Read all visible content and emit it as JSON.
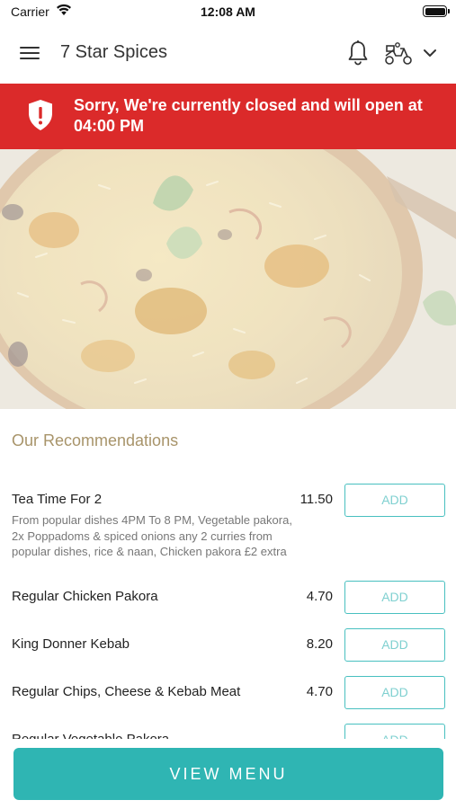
{
  "status_bar": {
    "carrier": "Carrier",
    "time": "12:08 AM",
    "wifi_icon": "wifi-icon",
    "battery_icon": "battery-icon"
  },
  "header": {
    "title": "7 Star Spices",
    "menu_icon": "hamburger-menu-icon",
    "bell_icon": "bell-icon",
    "delivery_icon": "scooter-icon",
    "dropdown_icon": "chevron-down-icon"
  },
  "banner": {
    "text": "Sorry, We're currently closed and will open at 04:00 PM",
    "icon": "shield-alert-icon",
    "background": "#db2a2a"
  },
  "hero": {
    "icon": "food-photo"
  },
  "recommendations": {
    "title": "Our Recommendations",
    "add_label": "ADD",
    "items": [
      {
        "name": "Tea Time For 2",
        "description": "From popular dishes 4PM To 8 PM, Vegetable pakora, 2x Poppadoms & spiced onions any 2 curries from popular dishes, rice & naan, Chicken pakora £2 extra",
        "price": "11.50"
      },
      {
        "name": "Regular Chicken Pakora",
        "description": "",
        "price": "4.70"
      },
      {
        "name": "King Donner Kebab",
        "description": "",
        "price": "8.20"
      },
      {
        "name": "Regular Chips, Cheese & Kebab Meat",
        "description": "",
        "price": "4.70"
      },
      {
        "name": "Regular Vegetable Pakora",
        "description": "",
        "price": ""
      }
    ]
  },
  "footer": {
    "view_menu_label": "VIEW MENU",
    "accent": "#2fb5b3"
  }
}
